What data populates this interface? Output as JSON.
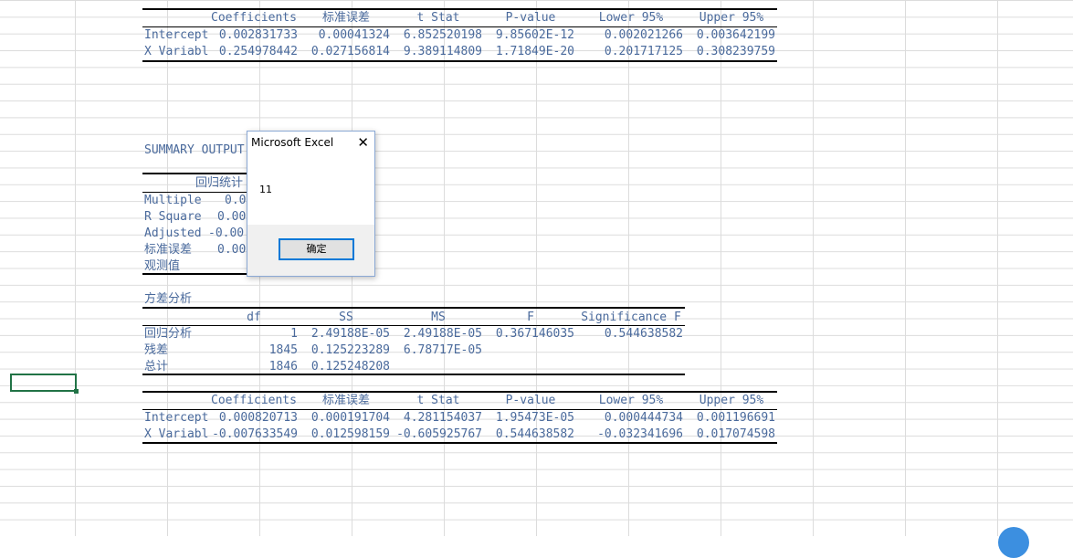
{
  "top_table": {
    "header": [
      "",
      "Coefficients",
      "标准误差",
      "t Stat",
      "P-value",
      "Lower 95%",
      "Upper 95%"
    ],
    "rows": [
      [
        "Intercept",
        "0.002831733",
        "0.00041324",
        "6.852520198",
        "9.85602E-12",
        "0.002021266",
        "0.003642199"
      ],
      [
        "X Variabl",
        "0.254978442",
        "0.027156814",
        "9.389114809",
        "1.71849E-20",
        "0.201717125",
        "0.308239759"
      ]
    ]
  },
  "summary": {
    "title": "SUMMARY OUTPUT",
    "reg_stats_header": "回归统计",
    "rows": [
      [
        "Multiple",
        "0.0"
      ],
      [
        "R Square",
        "0.00"
      ],
      [
        "Adjusted",
        "-0.00"
      ],
      [
        "标准误差",
        "0.00"
      ],
      [
        "观测值",
        ""
      ]
    ]
  },
  "anova": {
    "title": "方差分析",
    "header": [
      "",
      "df",
      "SS",
      "MS",
      "F",
      "Significance F"
    ],
    "rows": [
      [
        "回归分析",
        "1",
        "2.49188E-05",
        "2.49188E-05",
        "0.367146035",
        "0.544638582"
      ],
      [
        "残差",
        "1845",
        "0.125223289",
        "6.78717E-05",
        "",
        ""
      ],
      [
        "总计",
        "1846",
        "0.125248208",
        "",
        "",
        ""
      ]
    ]
  },
  "bottom_table": {
    "header": [
      "",
      "Coefficients",
      "标准误差",
      "t Stat",
      "P-value",
      "Lower 95%",
      "Upper 95%"
    ],
    "rows": [
      [
        "Intercept",
        "0.000820713",
        "0.000191704",
        "4.281154037",
        "1.95473E-05",
        "0.000444734",
        "0.001196691"
      ],
      [
        "X Variabl",
        "-0.007633549",
        "0.012598159",
        "-0.605925767",
        "0.544638582",
        "-0.032341696",
        "0.017074598"
      ]
    ]
  },
  "dialog": {
    "title": "Microsoft Excel",
    "close_glyph": "✕",
    "message": "11",
    "ok_label": "确定"
  },
  "colors": {
    "cell_text": "#4a6a9c",
    "selection": "#217346",
    "button_border": "#0078d7"
  }
}
